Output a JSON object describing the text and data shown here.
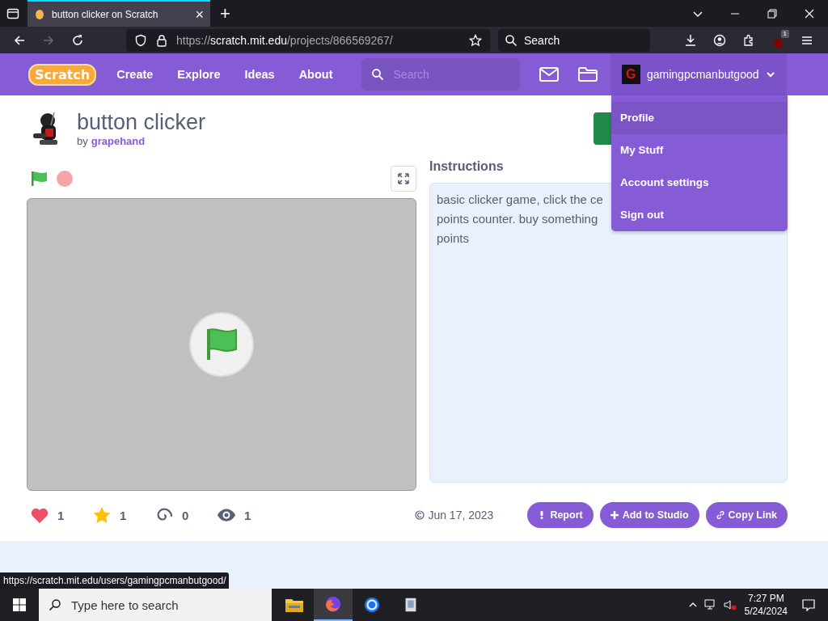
{
  "browser": {
    "tab_title": "button clicker on Scratch",
    "tab_close": "×",
    "new_tab": "+",
    "url": {
      "scheme": "https://",
      "domain": "scratch.mit.edu",
      "path": "/projects/866569267/"
    },
    "search_placeholder": "Search",
    "forward_disabled": true,
    "extension_badge": "1",
    "status_url": "https://scratch.mit.edu/users/gamingpcmanbutgood/"
  },
  "nav": {
    "logo": "Scratch",
    "links": [
      "Create",
      "Explore",
      "Ideas",
      "About"
    ],
    "search_placeholder": "Search",
    "username": "gamingpcmanbutgood",
    "avatar_letter": "G"
  },
  "user_menu": [
    {
      "label": "Profile",
      "selected": true
    },
    {
      "label": "My Stuff",
      "selected": false
    },
    {
      "label": "Account settings",
      "selected": false
    },
    {
      "label": "Sign out",
      "selected": false
    }
  ],
  "project": {
    "title": "button clicker",
    "by": "by",
    "author": "grapehand",
    "instructions_heading": "Instructions",
    "instructions_lines": [
      "basic clicker game, click the ce",
      "points counter. buy something",
      "points"
    ]
  },
  "stats": [
    {
      "kind": "love",
      "count": "1"
    },
    {
      "kind": "favorite",
      "count": "1"
    },
    {
      "kind": "remix",
      "count": "0"
    },
    {
      "kind": "view",
      "count": "1"
    }
  ],
  "date": "Jun 17, 2023",
  "actions": [
    {
      "kind": "report",
      "label": "Report"
    },
    {
      "kind": "studio",
      "label": "Add to Studio"
    },
    {
      "kind": "link",
      "label": "Copy Link"
    }
  ],
  "taskbar": {
    "search_placeholder": "Type here to search",
    "time": "7:27 PM",
    "date": "5/24/2024"
  }
}
